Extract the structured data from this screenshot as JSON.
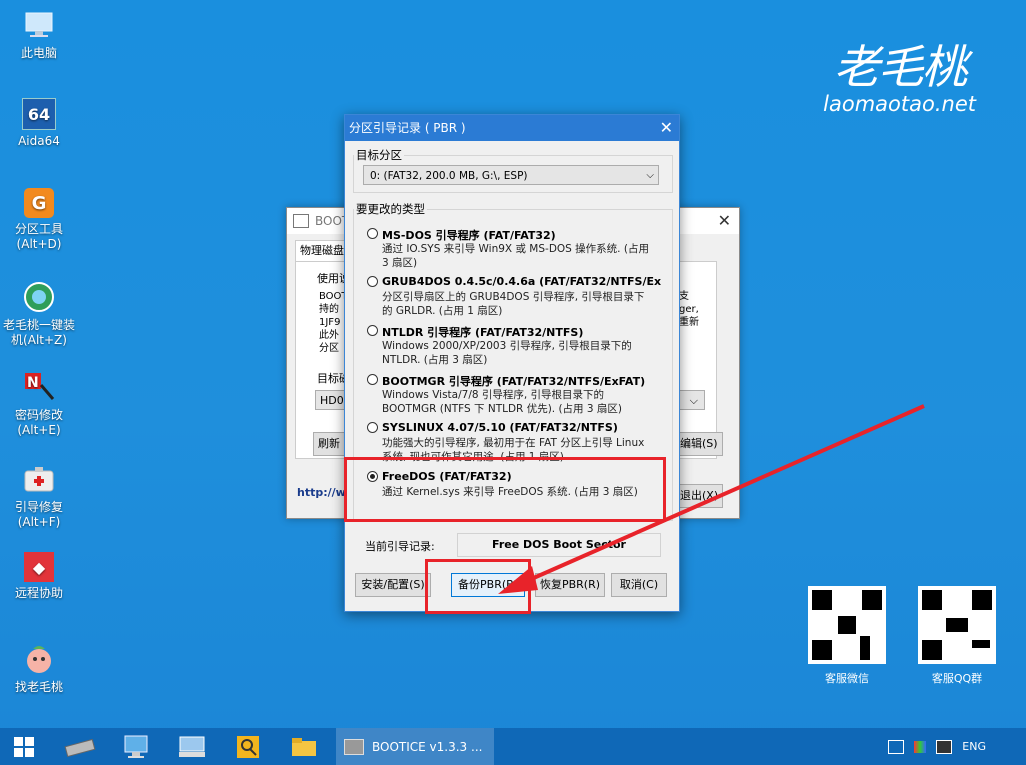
{
  "desktop": {
    "icons": [
      {
        "label": "此电脑",
        "icon": "computer-icon"
      },
      {
        "label": "Aida64",
        "icon": "aida64-icon"
      },
      {
        "label": "分区工具\n(Alt+D)",
        "icon": "partition-tool-icon"
      },
      {
        "label": "老毛桃一键装\n机(Alt+Z)",
        "icon": "install-icon"
      },
      {
        "label": "密码修改\n(Alt+E)",
        "icon": "password-icon"
      },
      {
        "label": "引导修复\n(Alt+F)",
        "icon": "boot-repair-icon"
      },
      {
        "label": "远程协助",
        "icon": "remote-icon"
      },
      {
        "label": "找老毛桃",
        "icon": "peach-icon"
      }
    ],
    "brand": {
      "name": "老毛桃",
      "url": "laomaotao.net"
    },
    "qr_codes": [
      {
        "label": "客服微信"
      },
      {
        "label": "客服QQ群"
      }
    ]
  },
  "bg_window": {
    "title": "BOOTI",
    "tab1": "物理磁盘",
    "use_label": "使用说",
    "text_lines": [
      "BOOT",
      "持的",
      "1JF9",
      "此外",
      "分区"
    ],
    "right_lines": [
      "支",
      "ger,",
      "重新"
    ],
    "target_label": "目标磁",
    "disk_value": "HD0:",
    "refresh": "刷新",
    "edit": "编辑(S)",
    "exit": "退出(X)",
    "link": "http://w"
  },
  "dialog": {
    "title": "分区引导记录 ( PBR )",
    "target_group": "目标分区",
    "target_value": "0: (FAT32, 200.0 MB, G:\\, ESP)",
    "type_group": "要更改的类型",
    "options": [
      {
        "name": "MS-DOS 引导程序 (FAT/FAT32)",
        "desc": "通过 IO.SYS 来引导 Win9X 或 MS-DOS 操作系统. (占用 3 扇区)",
        "selected": false
      },
      {
        "name": "GRUB4DOS 0.4.5c/0.4.6a (FAT/FAT32/NTFS/Ex",
        "desc": "分区引导扇区上的 GRUB4DOS 引导程序, 引导根目录下的 GRLDR. (占用 1 扇区)",
        "selected": false
      },
      {
        "name": "NTLDR 引导程序 (FAT/FAT32/NTFS)",
        "desc": "Windows 2000/XP/2003 引导程序, 引导根目录下的 NTLDR. (占用 3 扇区)",
        "selected": false
      },
      {
        "name": "BOOTMGR 引导程序 (FAT/FAT32/NTFS/ExFAT)",
        "desc": "Windows Vista/7/8 引导程序, 引导根目录下的 BOOTMGR (NTFS 下 NTLDR 优先). (占用 3 扇区)",
        "selected": false
      },
      {
        "name": "SYSLINUX 4.07/5.10 (FAT/FAT32/NTFS)",
        "desc": "功能强大的引导程序, 最初用于在 FAT 分区上引导 Linux 系统, 现也可作其它用途. (占用 1 扇区)",
        "selected": false
      },
      {
        "name": "FreeDOS (FAT/FAT32)",
        "desc": "通过 Kernel.sys 来引导 FreeDOS 系统. (占用 3 扇区)",
        "selected": true
      }
    ],
    "current_label": "当前引导记录:",
    "current_value": "Free DOS Boot Sector",
    "buttons": {
      "install": "安装/配置(S)",
      "backup": "备份PBR(B)",
      "restore": "恢复PBR(R)",
      "cancel": "取消(C)"
    }
  },
  "taskbar": {
    "active_label": "BOOTICE v1.3.3 ...",
    "lang": "ENG"
  },
  "colors": {
    "highlight": "#e8232a",
    "accent": "#2b7bd4"
  }
}
